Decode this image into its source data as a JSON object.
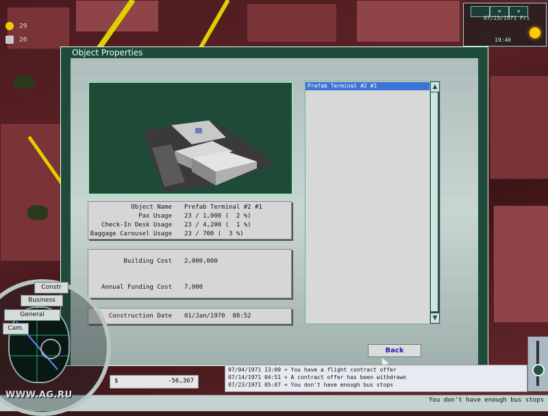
{
  "top_left": {
    "happy_count": "29",
    "key_count": "26"
  },
  "top_right": {
    "date": "07/23/1971 Fri",
    "time": "19:46"
  },
  "dialog": {
    "title": "Object Properties",
    "fields": [
      {
        "label": "Object Name",
        "value": "Prefab Terminal #2 #1"
      },
      {
        "label": "Pax Usage",
        "value": "23 / 1,000 (  2 %)"
      },
      {
        "label": "Check-In Desk Usage",
        "value": "23 / 4,200 (  1 %)"
      },
      {
        "label": "Baggage Carousel Usage",
        "value": "23 / 700 (  3 %)"
      }
    ],
    "costs": [
      {
        "label": "Building Cost",
        "value": "2,000,000"
      },
      {
        "label": "Annual Funding Cost",
        "value": "7,000"
      }
    ],
    "construction": {
      "label": "Construction Date",
      "value": "01/Jan/1970  08:52"
    },
    "list": {
      "items": [
        "Prefab Terminal #2 #1"
      ]
    },
    "back_label": "Back"
  },
  "messages": [
    "07/04/1971 13:00 + You have a flight contract offer",
    "07/14/1971 04:51 + A contract offer has been withdrawn",
    "07/23/1971 05:07 + You don't have enough bus stops"
  ],
  "money": {
    "symbol": "$",
    "value": "-56,367"
  },
  "status": "You don't have enough bus stops",
  "radial_menu": {
    "items": [
      "Constr",
      "Business",
      "General",
      "Cam."
    ]
  },
  "watermark": "WWW.AG.RU"
}
